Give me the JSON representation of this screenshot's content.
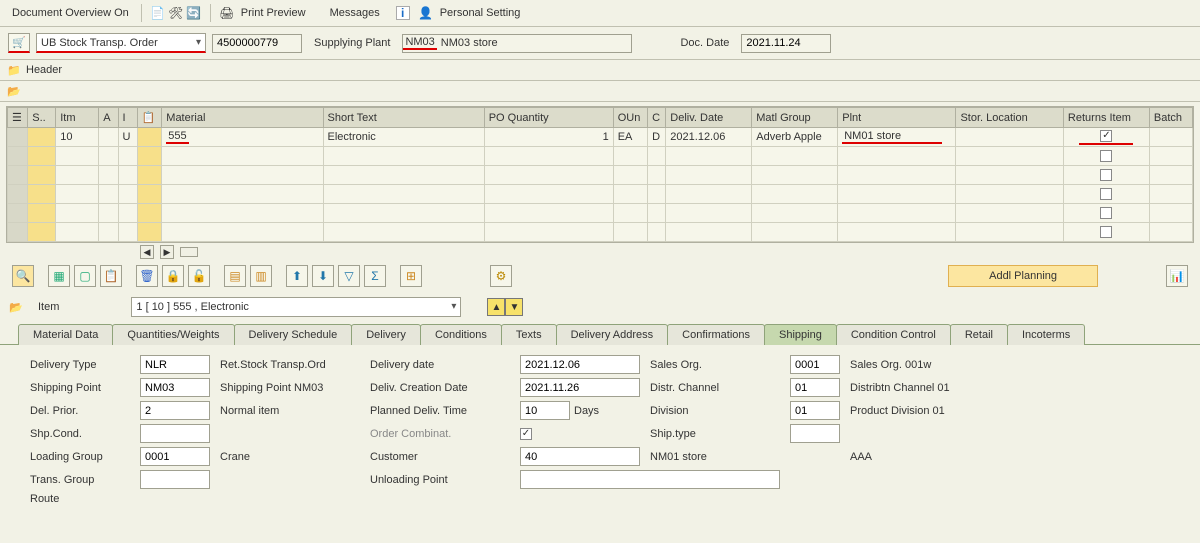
{
  "toolbar": {
    "doc_overview": "Document Overview On",
    "print_preview": "Print Preview",
    "messages": "Messages",
    "personal_setting": "Personal Setting"
  },
  "header_bar": {
    "order_type": "UB Stock Transp. Order",
    "order_number": "4500000779",
    "supplying_plant_label": "Supplying Plant",
    "supplying_plant_code": "NM03",
    "supplying_plant_name": "NM03 store",
    "doc_date_label": "Doc. Date",
    "doc_date": "2021.11.24"
  },
  "header_section_label": "Header",
  "items_table": {
    "columns": {
      "s": "S..",
      "itm": "Itm",
      "a": "A",
      "i": "I",
      "material": "Material",
      "short_text": "Short Text",
      "po_qty": "PO Quantity",
      "oun": "OUn",
      "c": "C",
      "deliv_date": "Deliv. Date",
      "matl_group": "Matl Group",
      "plnt": "Plnt",
      "stor_loc": "Stor. Location",
      "returns_item": "Returns Item",
      "batch": "Batch"
    },
    "rows": [
      {
        "itm": "10",
        "i": "U",
        "material": "555",
        "short_text": "Electronic",
        "po_qty": "1",
        "oun": "EA",
        "c": "D",
        "deliv_date": "2021.12.06",
        "matl_group": "Adverb Apple",
        "plnt": "NM01 store",
        "returns_item": true
      }
    ]
  },
  "buttons": {
    "addl_planning": "Addl Planning"
  },
  "item_section": {
    "label": "Item",
    "selected": "1 [ 10 ] 555 , Electronic"
  },
  "tabs": [
    "Material Data",
    "Quantities/Weights",
    "Delivery Schedule",
    "Delivery",
    "Conditions",
    "Texts",
    "Delivery Address",
    "Confirmations",
    "Shipping",
    "Condition Control",
    "Retail",
    "Incoterms"
  ],
  "active_tab": "Shipping",
  "shipping": {
    "delivery_type": {
      "label": "Delivery Type",
      "value": "NLR",
      "desc": "Ret.Stock Transp.Ord"
    },
    "shipping_point": {
      "label": "Shipping Point",
      "value": "NM03",
      "desc": "Shipping Point NM03"
    },
    "del_prior": {
      "label": "Del. Prior.",
      "value": "2",
      "desc": "Normal item"
    },
    "shp_cond": {
      "label": "Shp.Cond.",
      "value": "",
      "desc": ""
    },
    "loading_group": {
      "label": "Loading Group",
      "value": "0001",
      "desc": "Crane"
    },
    "trans_group": {
      "label": "Trans. Group",
      "value": "",
      "desc": ""
    },
    "route": {
      "label": "Route"
    },
    "delivery_date": {
      "label": "Delivery date",
      "value": "2021.12.06"
    },
    "deliv_creation_date": {
      "label": "Deliv. Creation Date",
      "value": "2021.11.26"
    },
    "planned_deliv_time": {
      "label": "Planned Deliv. Time",
      "value": "10",
      "unit": "Days"
    },
    "order_combinat": {
      "label": "Order Combinat.",
      "checked": true
    },
    "customer": {
      "label": "Customer",
      "value": "40",
      "desc": "NM01 store"
    },
    "unloading_point": {
      "label": "Unloading Point",
      "value": ""
    },
    "sales_org": {
      "label": "Sales Org.",
      "value": "0001",
      "desc": "Sales Org. 001w"
    },
    "distr_channel": {
      "label": "Distr. Channel",
      "value": "01",
      "desc": "Distribtn Channel 01"
    },
    "division": {
      "label": "Division",
      "value": "01",
      "desc": "Product Division 01"
    },
    "ship_type": {
      "label": "Ship.type",
      "desc": "AAA"
    }
  }
}
